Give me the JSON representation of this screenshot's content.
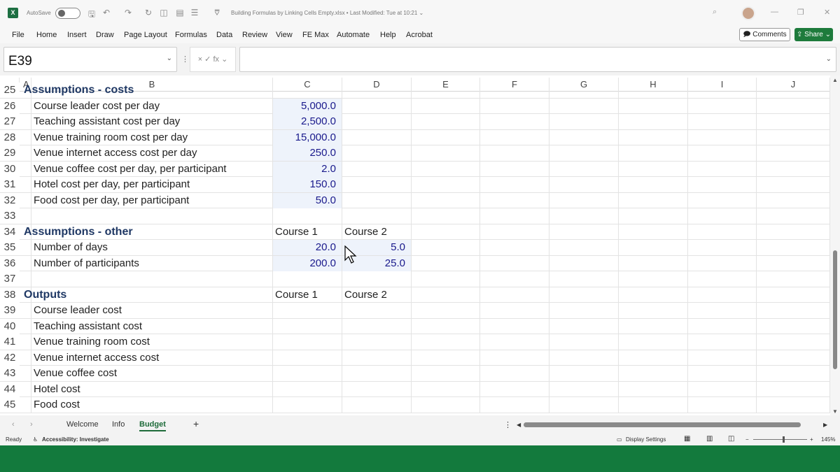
{
  "titlebar": {
    "app_icon": "X",
    "autosave_label": "AutoSave",
    "doc_title": "Building Formulas by Linking Cells Empty.xlsx • Last Modified: Tue at 10:21 ⌄"
  },
  "menu": {
    "tabs": [
      "File",
      "Home",
      "Insert",
      "Draw",
      "Page Layout",
      "Formulas",
      "Data",
      "Review",
      "View",
      "FE Max",
      "Automate",
      "Help",
      "Acrobat"
    ],
    "comments_label": "🗩 Comments",
    "share_label": "⇪ Share ⌄"
  },
  "formula_bar": {
    "name_box": "E39",
    "fx_label": "× ✓ fx ⌄",
    "formula_value": ""
  },
  "columns": [
    "A",
    "B",
    "C",
    "D",
    "E",
    "F",
    "G",
    "H",
    "I",
    "J"
  ],
  "rows": [
    {
      "num": "25",
      "b": "Assumptions - costs",
      "header": true,
      "c": "",
      "d": "",
      "c_input": false
    },
    {
      "num": "26",
      "b": "Course leader cost per day",
      "c": "5,000.0",
      "d": "",
      "c_input": true
    },
    {
      "num": "27",
      "b": "Teaching assistant cost per day",
      "c": "2,500.0",
      "d": "",
      "c_input": true
    },
    {
      "num": "28",
      "b": "Venue training room cost per day",
      "c": "15,000.0",
      "d": "",
      "c_input": true
    },
    {
      "num": "29",
      "b": "Venue internet access cost per day",
      "c": "250.0",
      "d": "",
      "c_input": true
    },
    {
      "num": "30",
      "b": "Venue coffee cost per day, per participant",
      "c": "2.0",
      "d": "",
      "c_input": true
    },
    {
      "num": "31",
      "b": "Hotel cost per day, per participant",
      "c": "150.0",
      "d": "",
      "c_input": true
    },
    {
      "num": "32",
      "b": "Food cost per day, per participant",
      "c": "50.0",
      "d": "",
      "c_input": true
    },
    {
      "num": "33",
      "b": "",
      "c": "",
      "d": ""
    },
    {
      "num": "34",
      "b": "Assumptions - other",
      "header": true,
      "c": "Course 1",
      "d": "Course 2"
    },
    {
      "num": "35",
      "b": "Number of days",
      "c": "20.0",
      "d": "5.0",
      "c_input": true,
      "d_input": true
    },
    {
      "num": "36",
      "b": "Number of participants",
      "c": "200.0",
      "d": "25.0",
      "c_input": true,
      "d_input": true
    },
    {
      "num": "37",
      "b": "",
      "c": "",
      "d": ""
    },
    {
      "num": "38",
      "b": "Outputs",
      "header": true,
      "c": "Course 1",
      "d": "Course 2"
    },
    {
      "num": "39",
      "b": "Course leader cost",
      "c": "",
      "d": ""
    },
    {
      "num": "40",
      "b": "Teaching assistant cost",
      "c": "",
      "d": ""
    },
    {
      "num": "41",
      "b": "Venue training room cost",
      "c": "",
      "d": ""
    },
    {
      "num": "42",
      "b": "Venue internet access cost",
      "c": "",
      "d": ""
    },
    {
      "num": "43",
      "b": "Venue coffee cost",
      "c": "",
      "d": ""
    },
    {
      "num": "44",
      "b": "Hotel cost",
      "c": "",
      "d": ""
    },
    {
      "num": "45",
      "b": "Food cost",
      "c": "",
      "d": ""
    }
  ],
  "sheets": {
    "tabs": [
      "Welcome",
      "Info",
      "Budget"
    ],
    "active": "Budget",
    "add_label": "+"
  },
  "status": {
    "ready": "Ready",
    "accessibility": "Accessibility: Investigate",
    "display_settings": "Display Settings",
    "zoom": "145%"
  },
  "colors": {
    "input_fill": "#eef3fb",
    "input_text": "#1a1a8c",
    "header_text": "#1f3864",
    "brand_green": "#137a3d"
  }
}
